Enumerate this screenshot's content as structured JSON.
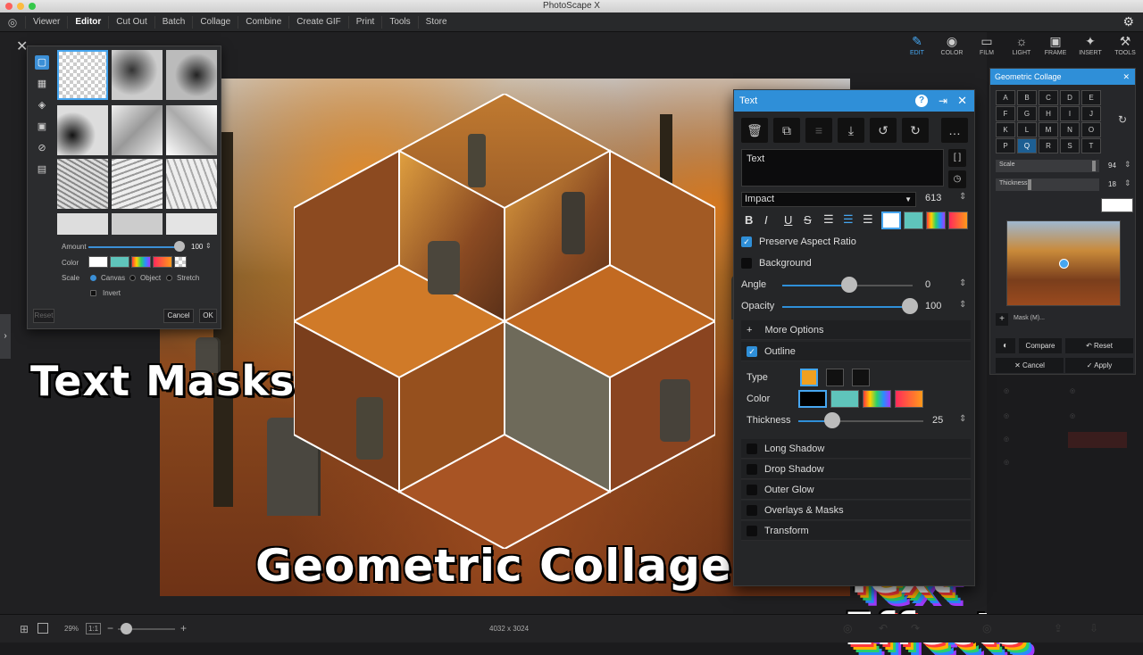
{
  "window": {
    "title": "PhotoScape X"
  },
  "menu": {
    "items": [
      "Viewer",
      "Editor",
      "Cut Out",
      "Batch",
      "Collage",
      "Combine",
      "Create GIF",
      "Print",
      "Tools",
      "Store"
    ],
    "active": "Editor"
  },
  "overlay_text": {
    "left": "Text Masks",
    "center": "Geometric Collage",
    "right": "Text Effects"
  },
  "mask_panel": {
    "amount_label": "Amount",
    "amount_value": "100",
    "color_label": "Color",
    "scale_label": "Scale",
    "scale_options": [
      "Canvas",
      "Object",
      "Stretch"
    ],
    "scale_selected": "Canvas",
    "invert_label": "Invert",
    "reset_label": "Reset",
    "cancel_label": "Cancel",
    "ok_label": "OK"
  },
  "right_toolbar": [
    {
      "label": "EDIT",
      "icon": "edit-icon"
    },
    {
      "label": "COLOR",
      "icon": "color-icon"
    },
    {
      "label": "FILM",
      "icon": "film-icon"
    },
    {
      "label": "LIGHT",
      "icon": "light-icon"
    },
    {
      "label": "FRAME",
      "icon": "frame-icon"
    },
    {
      "label": "INSERT",
      "icon": "insert-icon"
    },
    {
      "label": "TOOLS",
      "icon": "tools-icon"
    }
  ],
  "text_panel": {
    "title": "Text",
    "text_value": "Text",
    "font": "Impact",
    "font_size": "613",
    "preserve_aspect_label": "Preserve Aspect Ratio",
    "background_label": "Background",
    "angle_label": "Angle",
    "angle_value": "0",
    "opacity_label": "Opacity",
    "opacity_value": "100",
    "more_options_label": "More Options",
    "outline_label": "Outline",
    "type_label": "Type",
    "color_label": "Color",
    "thickness_label": "Thickness",
    "thickness_value": "25",
    "sections": [
      "Long Shadow",
      "Drop Shadow",
      "Outer Glow",
      "Overlays & Masks",
      "Transform"
    ]
  },
  "gc_panel": {
    "title": "Geometric Collage",
    "letters": [
      "A",
      "B",
      "C",
      "D",
      "E",
      "F",
      "G",
      "H",
      "I",
      "J",
      "K",
      "L",
      "M",
      "N",
      "O",
      "P",
      "Q",
      "R",
      "S",
      "T"
    ],
    "selected_letter": "Q",
    "scale_label": "Scale",
    "scale_value": "94",
    "thickness_label": "Thickness",
    "thickness_value": "18",
    "mask_label": "Mask (M)...",
    "compare_label": "Compare",
    "reset_label": "Reset",
    "cancel_label": "Cancel",
    "apply_label": "Apply"
  },
  "status": {
    "zoom": "29%",
    "ratio": "1:1",
    "dimensions": "4032 x 3024"
  },
  "colors": {
    "accent": "#2f8fd8",
    "outline_swatch": "#f0a020"
  }
}
